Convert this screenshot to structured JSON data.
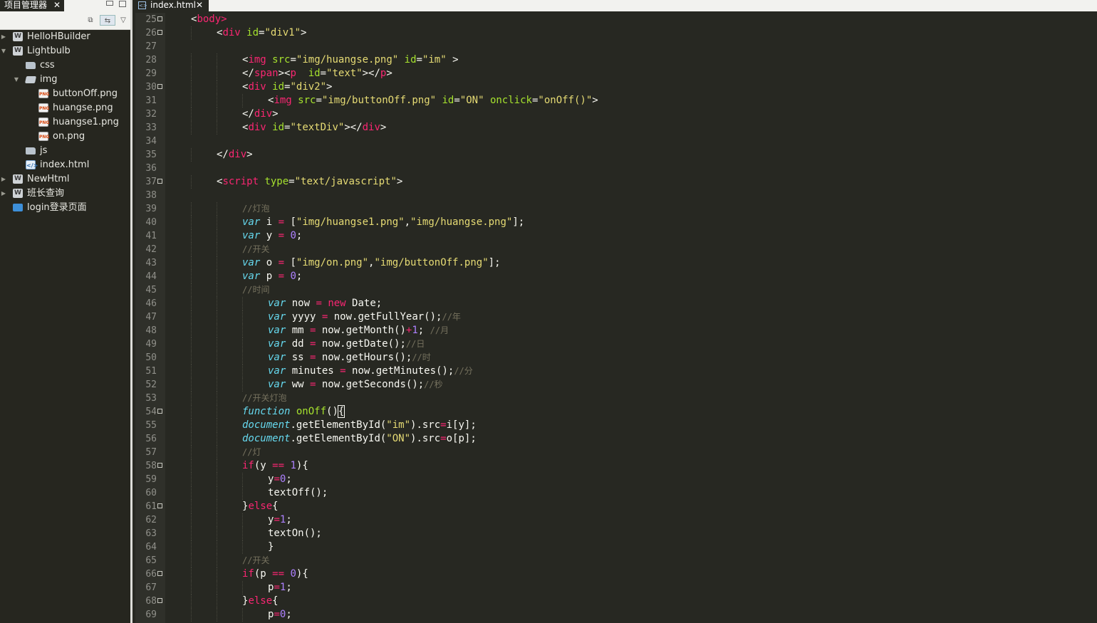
{
  "sidebar": {
    "tab_label": "项目管理器",
    "tab_close": "✕",
    "toolbar_icons": [
      "collapse-all-icon",
      "link-with-editor-icon",
      "view-menu-icon"
    ],
    "tree": [
      {
        "label": "HelloHBuilder",
        "depth": 0,
        "icon": "project",
        "expander": "collapsed"
      },
      {
        "label": "Lightbulb",
        "depth": 0,
        "icon": "project",
        "expander": "expanded"
      },
      {
        "label": "css",
        "depth": 1,
        "icon": "folder",
        "expander": "none"
      },
      {
        "label": "img",
        "depth": 1,
        "icon": "folder-open",
        "expander": "expanded"
      },
      {
        "label": "buttonOff.png",
        "depth": 2,
        "icon": "png",
        "expander": "none"
      },
      {
        "label": "huangse.png",
        "depth": 2,
        "icon": "png",
        "expander": "none"
      },
      {
        "label": "huangse1.png",
        "depth": 2,
        "icon": "png",
        "expander": "none"
      },
      {
        "label": "on.png",
        "depth": 2,
        "icon": "png",
        "expander": "none"
      },
      {
        "label": "js",
        "depth": 1,
        "icon": "folder",
        "expander": "none"
      },
      {
        "label": "index.html",
        "depth": 1,
        "icon": "html",
        "expander": "none"
      },
      {
        "label": "NewHtml",
        "depth": 0,
        "icon": "project",
        "expander": "collapsed"
      },
      {
        "label": "班长查询",
        "depth": 0,
        "icon": "project",
        "expander": "collapsed"
      },
      {
        "label": "login登录页面",
        "depth": 0,
        "icon": "blue-folder",
        "expander": "none"
      }
    ]
  },
  "editor": {
    "tab_label": "index.html",
    "tab_close": "✕",
    "colors": {
      "background": "#272822",
      "tag": "#f92672",
      "attribute": "#a6e22e",
      "string": "#e6db74",
      "keyword": "#66d9ef",
      "number": "#ae81ff",
      "comment": "#75715e"
    },
    "lines": [
      {
        "n": "25",
        "fold": true,
        "indent": 1,
        "tokens": [
          [
            "<",
            "punct"
          ],
          [
            "body",
            "tag"
          ],
          [
            ">",
            "tag"
          ]
        ]
      },
      {
        "n": "26",
        "fold": true,
        "indent": 2,
        "tokens": [
          [
            "<",
            "punct"
          ],
          [
            "div",
            "tag"
          ],
          [
            " ",
            "plain"
          ],
          [
            "id",
            "attr"
          ],
          [
            "=",
            "punct"
          ],
          [
            "\"div1\"",
            "str"
          ],
          [
            ">",
            "punct"
          ]
        ]
      },
      {
        "n": "27",
        "fold": false,
        "indent": 0,
        "tokens": []
      },
      {
        "n": "28",
        "fold": false,
        "indent": 3,
        "tokens": [
          [
            "<",
            "punct"
          ],
          [
            "img",
            "tag"
          ],
          [
            " ",
            "plain"
          ],
          [
            "src",
            "attr"
          ],
          [
            "=",
            "punct"
          ],
          [
            "\"img/huangse.png\"",
            "str"
          ],
          [
            " ",
            "plain"
          ],
          [
            "id",
            "attr"
          ],
          [
            "=",
            "punct"
          ],
          [
            "\"im\"",
            "str"
          ],
          [
            " >",
            "punct"
          ]
        ]
      },
      {
        "n": "29",
        "fold": false,
        "indent": 3,
        "tokens": [
          [
            "</",
            "punct"
          ],
          [
            "span",
            "tag"
          ],
          [
            "><",
            "punct"
          ],
          [
            "p",
            "tag"
          ],
          [
            "  ",
            "plain"
          ],
          [
            "id",
            "attr"
          ],
          [
            "=",
            "punct"
          ],
          [
            "\"text\"",
            "str"
          ],
          [
            "></",
            "punct"
          ],
          [
            "p",
            "tag"
          ],
          [
            ">",
            "punct"
          ]
        ]
      },
      {
        "n": "30",
        "fold": true,
        "indent": 3,
        "tokens": [
          [
            "<",
            "punct"
          ],
          [
            "div",
            "tag"
          ],
          [
            " ",
            "plain"
          ],
          [
            "id",
            "attr"
          ],
          [
            "=",
            "punct"
          ],
          [
            "\"div2\"",
            "str"
          ],
          [
            ">",
            "punct"
          ]
        ]
      },
      {
        "n": "31",
        "fold": false,
        "indent": 4,
        "tokens": [
          [
            "<",
            "punct"
          ],
          [
            "img",
            "tag"
          ],
          [
            " ",
            "plain"
          ],
          [
            "src",
            "attr"
          ],
          [
            "=",
            "punct"
          ],
          [
            "\"img/buttonOff.png\"",
            "str"
          ],
          [
            " ",
            "plain"
          ],
          [
            "id",
            "attr"
          ],
          [
            "=",
            "punct"
          ],
          [
            "\"ON\"",
            "str"
          ],
          [
            " ",
            "plain"
          ],
          [
            "onclick",
            "attr"
          ],
          [
            "=",
            "punct"
          ],
          [
            "\"onOff()\"",
            "str"
          ],
          [
            ">",
            "punct"
          ]
        ]
      },
      {
        "n": "32",
        "fold": false,
        "indent": 3,
        "tokens": [
          [
            "</",
            "punct"
          ],
          [
            "div",
            "tag"
          ],
          [
            ">",
            "punct"
          ]
        ]
      },
      {
        "n": "33",
        "fold": false,
        "indent": 3,
        "tokens": [
          [
            "<",
            "punct"
          ],
          [
            "div",
            "tag"
          ],
          [
            " ",
            "plain"
          ],
          [
            "id",
            "attr"
          ],
          [
            "=",
            "punct"
          ],
          [
            "\"textDiv\"",
            "str"
          ],
          [
            "></",
            "punct"
          ],
          [
            "div",
            "tag"
          ],
          [
            ">",
            "punct"
          ]
        ]
      },
      {
        "n": "34",
        "fold": false,
        "indent": 0,
        "tokens": []
      },
      {
        "n": "35",
        "fold": false,
        "indent": 2,
        "tokens": [
          [
            "</",
            "punct"
          ],
          [
            "div",
            "tag"
          ],
          [
            ">",
            "punct"
          ]
        ]
      },
      {
        "n": "36",
        "fold": false,
        "indent": 0,
        "tokens": []
      },
      {
        "n": "37",
        "fold": true,
        "indent": 2,
        "tokens": [
          [
            "<",
            "punct"
          ],
          [
            "script",
            "tag"
          ],
          [
            " ",
            "plain"
          ],
          [
            "type",
            "attr"
          ],
          [
            "=",
            "punct"
          ],
          [
            "\"text/javascript\"",
            "str"
          ],
          [
            ">",
            "punct"
          ]
        ]
      },
      {
        "n": "38",
        "fold": false,
        "indent": 0,
        "tokens": []
      },
      {
        "n": "39",
        "fold": false,
        "indent": 3,
        "tokens": [
          [
            "//灯泡",
            "comment"
          ]
        ]
      },
      {
        "n": "40",
        "fold": false,
        "indent": 3,
        "tokens": [
          [
            "var",
            "kw"
          ],
          [
            " i ",
            "plain"
          ],
          [
            "=",
            "op"
          ],
          [
            " [",
            "plain"
          ],
          [
            "\"img/huangse1.png\"",
            "str"
          ],
          [
            ",",
            "plain"
          ],
          [
            "\"img/huangse.png\"",
            "str"
          ],
          [
            "];",
            "plain"
          ]
        ]
      },
      {
        "n": "41",
        "fold": false,
        "indent": 3,
        "tokens": [
          [
            "var",
            "kw"
          ],
          [
            " y ",
            "plain"
          ],
          [
            "=",
            "op"
          ],
          [
            " ",
            "plain"
          ],
          [
            "0",
            "num"
          ],
          [
            ";",
            "plain"
          ]
        ]
      },
      {
        "n": "42",
        "fold": false,
        "indent": 3,
        "tokens": [
          [
            "//开关",
            "comment"
          ]
        ]
      },
      {
        "n": "43",
        "fold": false,
        "indent": 3,
        "tokens": [
          [
            "var",
            "kw"
          ],
          [
            " o ",
            "plain"
          ],
          [
            "=",
            "op"
          ],
          [
            " [",
            "plain"
          ],
          [
            "\"img/on.png\"",
            "str"
          ],
          [
            ",",
            "plain"
          ],
          [
            "\"img/buttonOff.png\"",
            "str"
          ],
          [
            "];",
            "plain"
          ]
        ]
      },
      {
        "n": "44",
        "fold": false,
        "indent": 3,
        "tokens": [
          [
            "var",
            "kw"
          ],
          [
            " p ",
            "plain"
          ],
          [
            "=",
            "op"
          ],
          [
            " ",
            "plain"
          ],
          [
            "0",
            "num"
          ],
          [
            ";",
            "plain"
          ]
        ]
      },
      {
        "n": "45",
        "fold": false,
        "indent": 3,
        "tokens": [
          [
            "//时间",
            "comment"
          ]
        ]
      },
      {
        "n": "46",
        "fold": false,
        "indent": 4,
        "tokens": [
          [
            "var",
            "kw"
          ],
          [
            " now ",
            "plain"
          ],
          [
            "=",
            "op"
          ],
          [
            " ",
            "plain"
          ],
          [
            "new",
            "op"
          ],
          [
            " Date;",
            "plain"
          ]
        ]
      },
      {
        "n": "47",
        "fold": false,
        "indent": 4,
        "tokens": [
          [
            "var",
            "kw"
          ],
          [
            " yyyy ",
            "plain"
          ],
          [
            "=",
            "op"
          ],
          [
            " now.getFullYear();",
            "plain"
          ],
          [
            "//年",
            "comment"
          ]
        ]
      },
      {
        "n": "48",
        "fold": false,
        "indent": 4,
        "tokens": [
          [
            "var",
            "kw"
          ],
          [
            " mm ",
            "plain"
          ],
          [
            "=",
            "op"
          ],
          [
            " now.getMonth()",
            "plain"
          ],
          [
            "+",
            "op"
          ],
          [
            "1",
            "num"
          ],
          [
            "; ",
            "plain"
          ],
          [
            "//月",
            "comment"
          ]
        ]
      },
      {
        "n": "49",
        "fold": false,
        "indent": 4,
        "tokens": [
          [
            "var",
            "kw"
          ],
          [
            " dd ",
            "plain"
          ],
          [
            "=",
            "op"
          ],
          [
            " now.getDate();",
            "plain"
          ],
          [
            "//日",
            "comment"
          ]
        ]
      },
      {
        "n": "50",
        "fold": false,
        "indent": 4,
        "tokens": [
          [
            "var",
            "kw"
          ],
          [
            " ss ",
            "plain"
          ],
          [
            "=",
            "op"
          ],
          [
            " now.getHours();",
            "plain"
          ],
          [
            "//时",
            "comment"
          ]
        ]
      },
      {
        "n": "51",
        "fold": false,
        "indent": 4,
        "tokens": [
          [
            "var",
            "kw"
          ],
          [
            " minutes ",
            "plain"
          ],
          [
            "=",
            "op"
          ],
          [
            " now.getMinutes();",
            "plain"
          ],
          [
            "//分",
            "comment"
          ]
        ]
      },
      {
        "n": "52",
        "fold": false,
        "indent": 4,
        "tokens": [
          [
            "var",
            "kw"
          ],
          [
            " ww ",
            "plain"
          ],
          [
            "=",
            "op"
          ],
          [
            " now.getSeconds();",
            "plain"
          ],
          [
            "//秒",
            "comment"
          ]
        ]
      },
      {
        "n": "53",
        "fold": false,
        "indent": 3,
        "tokens": [
          [
            "//开关灯泡",
            "comment"
          ]
        ]
      },
      {
        "n": "54",
        "fold": true,
        "indent": 3,
        "tokens": [
          [
            "function",
            "kw"
          ],
          [
            " ",
            "plain"
          ],
          [
            "onOff",
            "func"
          ],
          [
            "()",
            "plain"
          ],
          [
            "{",
            "cursor"
          ]
        ]
      },
      {
        "n": "55",
        "fold": false,
        "indent": 3,
        "tokens": [
          [
            "document",
            "kw"
          ],
          [
            ".getElementById(",
            "plain"
          ],
          [
            "\"im\"",
            "str"
          ],
          [
            ").src",
            "plain"
          ],
          [
            "=",
            "op"
          ],
          [
            "i[y];",
            "plain"
          ]
        ]
      },
      {
        "n": "56",
        "fold": false,
        "indent": 3,
        "tokens": [
          [
            "document",
            "kw"
          ],
          [
            ".getElementById(",
            "plain"
          ],
          [
            "\"ON\"",
            "str"
          ],
          [
            ").src",
            "plain"
          ],
          [
            "=",
            "op"
          ],
          [
            "o[p];",
            "plain"
          ]
        ]
      },
      {
        "n": "57",
        "fold": false,
        "indent": 3,
        "tokens": [
          [
            "//灯",
            "comment"
          ]
        ]
      },
      {
        "n": "58",
        "fold": true,
        "indent": 3,
        "tokens": [
          [
            "if",
            "op"
          ],
          [
            "(y ",
            "plain"
          ],
          [
            "==",
            "op"
          ],
          [
            " ",
            "plain"
          ],
          [
            "1",
            "num"
          ],
          [
            "){",
            "plain"
          ]
        ]
      },
      {
        "n": "59",
        "fold": false,
        "indent": 4,
        "tokens": [
          [
            "y",
            "plain"
          ],
          [
            "=",
            "op"
          ],
          [
            "0",
            "num"
          ],
          [
            ";",
            "plain"
          ]
        ]
      },
      {
        "n": "60",
        "fold": false,
        "indent": 4,
        "tokens": [
          [
            "textOff();",
            "plain"
          ]
        ]
      },
      {
        "n": "61",
        "fold": true,
        "indent": 3,
        "tokens": [
          [
            "}",
            "plain"
          ],
          [
            "else",
            "op"
          ],
          [
            "{",
            "plain"
          ]
        ]
      },
      {
        "n": "62",
        "fold": false,
        "indent": 4,
        "tokens": [
          [
            "y",
            "plain"
          ],
          [
            "=",
            "op"
          ],
          [
            "1",
            "num"
          ],
          [
            ";",
            "plain"
          ]
        ]
      },
      {
        "n": "63",
        "fold": false,
        "indent": 4,
        "tokens": [
          [
            "textOn();",
            "plain"
          ]
        ]
      },
      {
        "n": "64",
        "fold": false,
        "indent": 4,
        "tokens": [
          [
            "}",
            "plain"
          ]
        ]
      },
      {
        "n": "65",
        "fold": false,
        "indent": 3,
        "tokens": [
          [
            "//开关",
            "comment"
          ]
        ]
      },
      {
        "n": "66",
        "fold": true,
        "indent": 3,
        "tokens": [
          [
            "if",
            "op"
          ],
          [
            "(p ",
            "plain"
          ],
          [
            "==",
            "op"
          ],
          [
            " ",
            "plain"
          ],
          [
            "0",
            "num"
          ],
          [
            "){",
            "plain"
          ]
        ]
      },
      {
        "n": "67",
        "fold": false,
        "indent": 4,
        "tokens": [
          [
            "p",
            "plain"
          ],
          [
            "=",
            "op"
          ],
          [
            "1",
            "num"
          ],
          [
            ";",
            "plain"
          ]
        ]
      },
      {
        "n": "68",
        "fold": true,
        "indent": 3,
        "tokens": [
          [
            "}",
            "plain"
          ],
          [
            "else",
            "op"
          ],
          [
            "{",
            "plain"
          ]
        ]
      },
      {
        "n": "69",
        "fold": false,
        "indent": 4,
        "tokens": [
          [
            "p",
            "plain"
          ],
          [
            "=",
            "op"
          ],
          [
            "0",
            "num"
          ],
          [
            ";",
            "plain"
          ]
        ]
      }
    ]
  }
}
